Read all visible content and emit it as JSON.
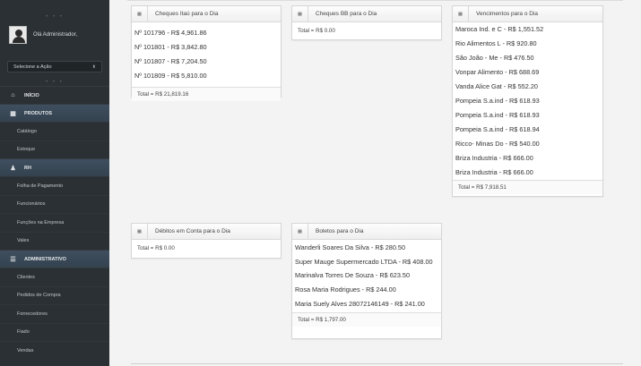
{
  "sidebar": {
    "greeting": "Olá Administrador,",
    "action_select": "Selecione a Ação",
    "home": "INÍCIO",
    "sections": [
      {
        "label": "PRODUTOS",
        "icon": "building-icon",
        "items": [
          "Catálogo",
          "Estoque"
        ]
      },
      {
        "label": "RH",
        "icon": "user-icon",
        "items": [
          "Folha de Pagamento",
          "Funcionários",
          "Funções na Empresa",
          "Vales"
        ]
      },
      {
        "label": "ADMINISTRATIVO",
        "icon": "database-icon",
        "items": [
          "Clientes",
          "Pedidos de Compra",
          "Fornecedores",
          "Fiado",
          "Vendas"
        ]
      }
    ]
  },
  "panels": {
    "cheques_itau": {
      "title": "Cheques Itaú para o Dia",
      "lines": [
        "Nº 101796 - R$ 4,961.86",
        "Nº 101801 - R$ 3,842.80",
        "Nº 101807 - R$ 7,204.50",
        "Nº 101809 - R$ 5,810.00"
      ],
      "total": "Total = R$ 21,819.16"
    },
    "cheques_bb": {
      "title": "Cheques BB para o Dia",
      "total": "Total = R$ 0.00"
    },
    "vencimentos": {
      "title": "Vencimentos para o Dia",
      "lines": [
        "Maroca Ind. e C - R$ 1,551.52",
        "Rio Alimentos L - R$ 920.80",
        "São João - Me - R$ 476.50",
        "Vonpar Alimento - R$ 688.69",
        "Vanda Alice Gat - R$ 552.20",
        "Pompeia S.a.ind - R$ 618.93",
        "Pompeia S.a.ind - R$ 618.93",
        "Pompeia S.a.ind - R$ 618.94",
        "Ricco- Minas Do - R$ 540.00",
        "Briza Industria - R$ 666.00",
        "Briza Industria - R$ 666.00"
      ],
      "total": "Total = R$ 7,918.51"
    },
    "debitos": {
      "title": "Débitos em Conta para o Dia",
      "total": "Total = R$ 0.00"
    },
    "boletos": {
      "title": "Boletos para o Dia",
      "lines": [
        "Wanderli Soares Da Silva - R$ 280.50",
        "Super Mauge Supermercado LTDA - R$ 408.00",
        "Marinalva Torres De Souza - R$ 623.50",
        "Rosa Maria Rodrigues - R$ 244.00",
        "Maria Suely Alves 28072146149 - R$ 241.00"
      ],
      "total": "Total = R$ 1,797.00"
    }
  }
}
